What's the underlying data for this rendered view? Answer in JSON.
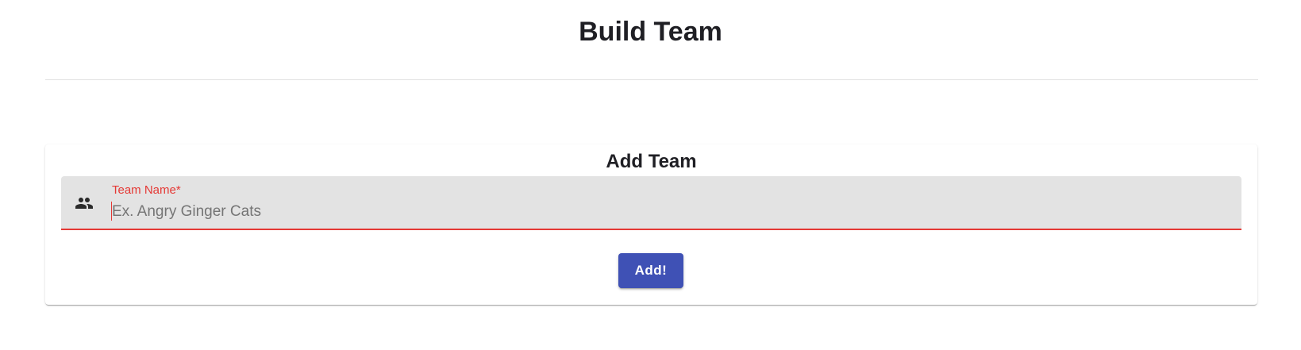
{
  "page": {
    "title": "Build Team"
  },
  "add_team_card": {
    "title": "Add Team",
    "team_name_field": {
      "label": "Team Name*",
      "placeholder": "Ex. Angry Ginger Cats",
      "value": "",
      "icon": "group-icon",
      "state": "error"
    },
    "add_button_label": "Add!"
  },
  "colors": {
    "primary": "#3f51b5",
    "error": "#e53935",
    "field_background": "#e3e3e3",
    "text": "#1f1f24"
  }
}
